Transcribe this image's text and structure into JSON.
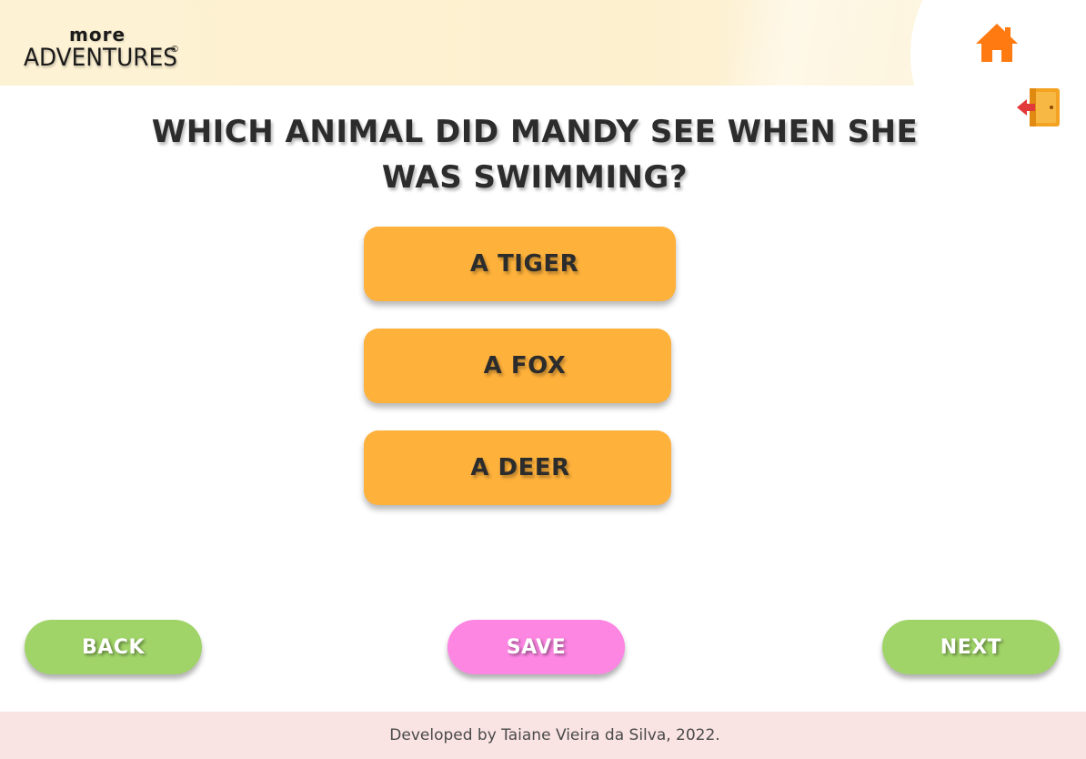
{
  "app": {
    "logo_top": "more",
    "logo_main": "ADVENTURES",
    "logo_mark": "©"
  },
  "icons": {
    "home": "home-icon",
    "exit": "exit-door-icon"
  },
  "quiz": {
    "question": "WHICH ANIMAL DID MANDY SEE WHEN SHE WAS SWIMMING?",
    "answers": [
      {
        "label": "A TIGER"
      },
      {
        "label": "A FOX"
      },
      {
        "label": "A DEER"
      }
    ]
  },
  "nav": {
    "back_label": "BACK",
    "save_label": "SAVE",
    "next_label": "NEXT"
  },
  "footer": {
    "credit": "Developed by Taiane Vieira da Silva, 2022."
  },
  "colors": {
    "answer_bg": "#feb13b",
    "back_next_bg": "#a0d468",
    "save_bg": "#fd86e3",
    "footer_bg": "#fae3e3",
    "header_bg": "#fdf2d4",
    "home_icon": "#ff7b12",
    "exit_door": "#f3a321",
    "exit_arrow": "#e23a3a"
  }
}
